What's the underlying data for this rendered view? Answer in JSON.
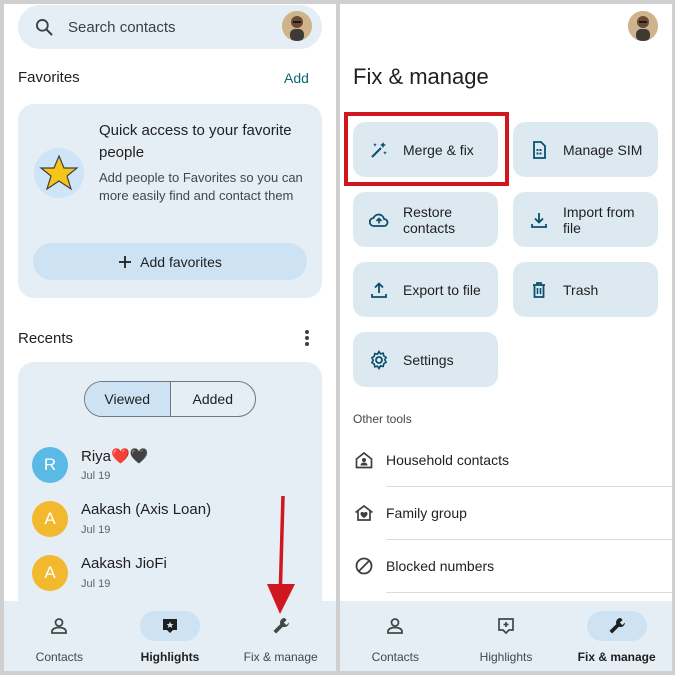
{
  "left": {
    "search": {
      "placeholder": "Search contacts"
    },
    "favorites": {
      "title": "Favorites",
      "add": "Add",
      "card_title": "Quick access to your favorite people",
      "card_desc": "Add people to Favorites so you can more easily find and contact them",
      "button": "Add favorites"
    },
    "recents": {
      "title": "Recents",
      "tabs": [
        "Viewed",
        "Added"
      ],
      "contacts": [
        {
          "initial": "R",
          "name": "Riya❤️🖤",
          "date": "Jul 19",
          "color": "#5bb9e6"
        },
        {
          "initial": "A",
          "name": "Aakash (Axis Loan)",
          "date": "Jul 19",
          "color": "#f2b92e"
        },
        {
          "initial": "A",
          "name": "Aakash JioFi",
          "date": "Jul 19",
          "color": "#f2b92e"
        }
      ]
    },
    "nav": [
      "Contacts",
      "Highlights",
      "Fix & manage"
    ],
    "active_nav": "Highlights"
  },
  "right": {
    "title": "Fix & manage",
    "tiles": [
      {
        "label": "Merge & fix",
        "icon": "magic-wand-icon"
      },
      {
        "label": "Manage SIM",
        "icon": "sim-card-icon"
      },
      {
        "label": "Restore contacts",
        "icon": "cloud-restore-icon"
      },
      {
        "label": "Import from file",
        "icon": "download-icon"
      },
      {
        "label": "Export to file",
        "icon": "upload-icon"
      },
      {
        "label": "Trash",
        "icon": "trash-icon"
      },
      {
        "label": "Settings",
        "icon": "gear-icon"
      }
    ],
    "other_tools": "Other tools",
    "tools": [
      {
        "label": "Household contacts",
        "icon": "household-icon"
      },
      {
        "label": "Family group",
        "icon": "family-home-icon"
      },
      {
        "label": "Blocked numbers",
        "icon": "block-icon"
      }
    ],
    "nav": [
      "Contacts",
      "Highlights",
      "Fix & manage"
    ],
    "active_nav": "Fix & manage"
  },
  "colors": {
    "accent": "#0b6b74",
    "highlight_box": "#d0161e",
    "arrow": "#d0161e",
    "surface": "#e5edf5",
    "tile": "#dde9f1"
  }
}
